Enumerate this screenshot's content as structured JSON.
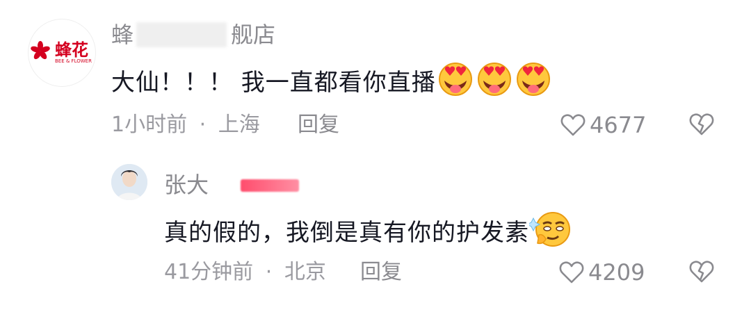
{
  "comments": [
    {
      "avatar_brand": "蜂花",
      "avatar_sub": "BEE & FLOWER",
      "author_prefix": "蜂",
      "author_suffix": "舰店",
      "text": "大仙！！！ 我一直都看你直播",
      "emoji": [
        "heart-eyes-tongue-emoji",
        "heart-eyes-tongue-emoji",
        "heart-eyes-tongue-emoji"
      ],
      "time": "1小时前",
      "location": "上海",
      "reply_label": "回复",
      "likes": "4677"
    },
    {
      "author_prefix": "张大",
      "text": "真的假的，我倒是真有你的护发素",
      "emoji": [
        "smirk-sparkle-emoji"
      ],
      "time": "41分钟前",
      "location": "北京",
      "reply_label": "回复",
      "likes": "4209"
    }
  ],
  "separator": "·",
  "colors": {
    "text": "#161823",
    "meta": "#9a9aa0",
    "brand_red": "#d4001f"
  }
}
